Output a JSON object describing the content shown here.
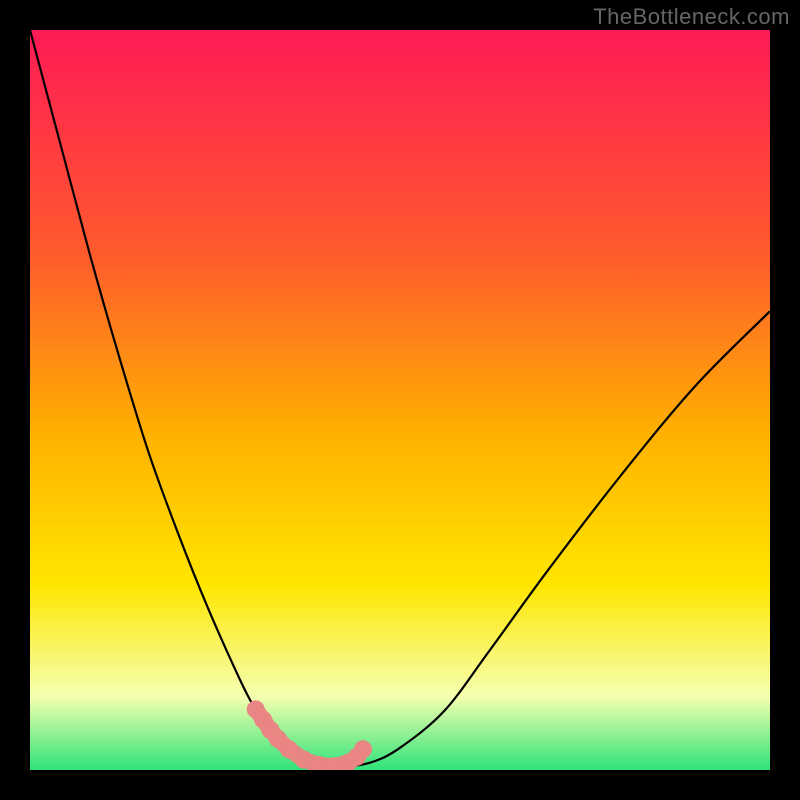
{
  "attribution": "TheBottleneck.com",
  "colors": {
    "gradient_top": "#ff1a56",
    "gradient_mid1": "#ff5a2d",
    "gradient_mid2": "#ffb200",
    "gradient_mid3": "#ffe600",
    "gradient_low": "#f6ffb0",
    "gradient_bottom": "#2fe37a",
    "curve": "#000000",
    "marker": "#e98582",
    "frame": "#000000"
  },
  "chart_data": {
    "type": "line",
    "title": "",
    "xlabel": "",
    "ylabel": "",
    "xlim": [
      0,
      100
    ],
    "ylim": [
      0,
      100
    ],
    "series": [
      {
        "name": "bottleneck-curve",
        "x": [
          0,
          4,
          8,
          12,
          16,
          20,
          24,
          28,
          30,
          32,
          34,
          36,
          38,
          40,
          42,
          46,
          50,
          56,
          62,
          70,
          80,
          90,
          100
        ],
        "y": [
          100,
          85,
          70,
          56,
          43,
          32,
          22,
          13,
          9,
          6,
          3.5,
          1.8,
          0.8,
          0.4,
          0.4,
          1,
          3,
          8,
          16,
          27,
          40,
          52,
          62
        ]
      }
    ],
    "markers": {
      "name": "highlight-points",
      "x": [
        30.5,
        31.5,
        32.5,
        33.5,
        35,
        37,
        39,
        41,
        43,
        44.2,
        45
      ],
      "y": [
        8.2,
        6.8,
        5.4,
        4.2,
        2.8,
        1.4,
        0.7,
        0.5,
        1.0,
        1.8,
        2.8
      ],
      "shape": "rounded",
      "color": "#e98582"
    },
    "background": {
      "type": "vertical-gradient",
      "stops": [
        {
          "pos": 0.0,
          "color": "#ff1a56"
        },
        {
          "pos": 0.3,
          "color": "#ff5a2d"
        },
        {
          "pos": 0.55,
          "color": "#ffb200"
        },
        {
          "pos": 0.75,
          "color": "#ffe600"
        },
        {
          "pos": 0.9,
          "color": "#f6ffb0"
        },
        {
          "pos": 1.0,
          "color": "#2fe37a"
        }
      ]
    }
  }
}
